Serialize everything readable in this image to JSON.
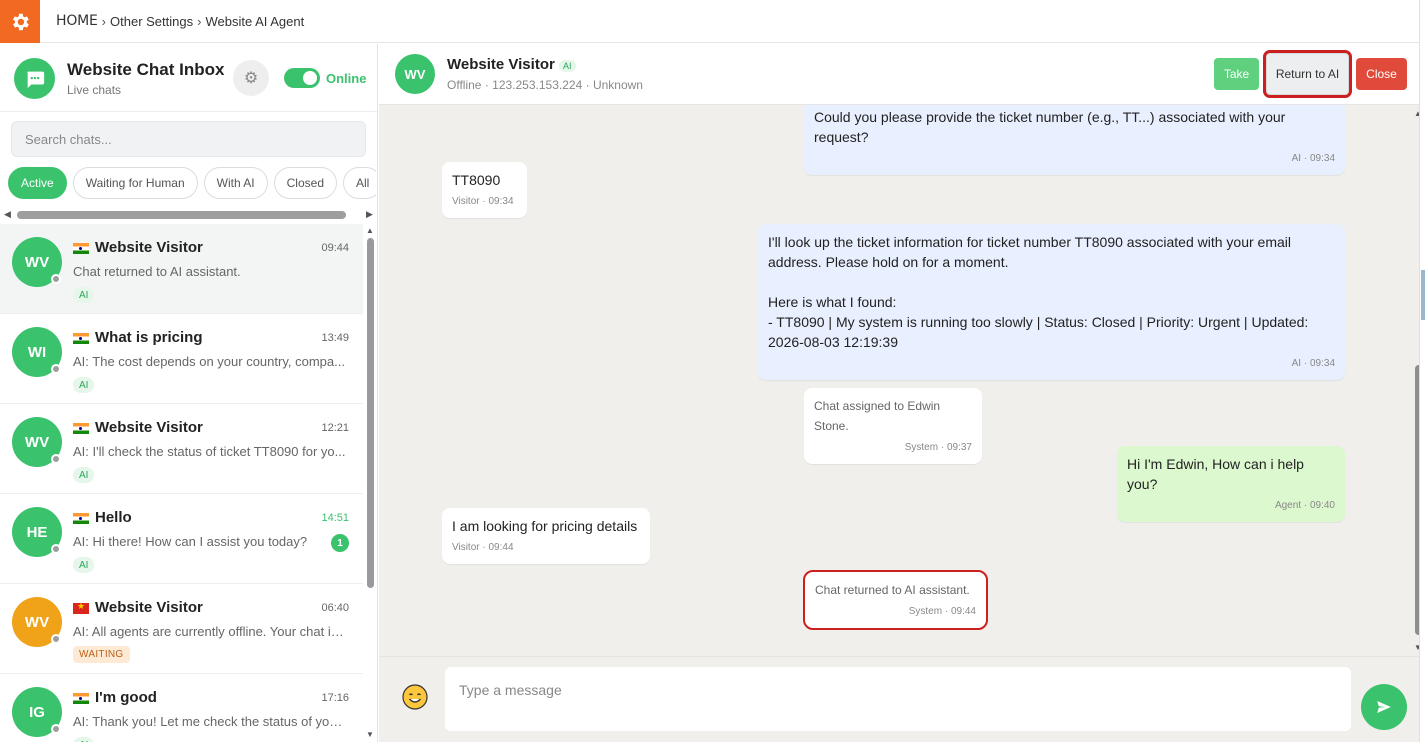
{
  "breadcrumb": {
    "home": "HOME",
    "items": [
      "Other Settings",
      "Website AI Agent"
    ]
  },
  "inbox": {
    "title": "Website Chat Inbox",
    "subtitle": "Live chats",
    "status_label": "Online",
    "search_placeholder": "Search chats...",
    "filters": [
      "Active",
      "Waiting for Human",
      "With AI",
      "Closed",
      "All"
    ],
    "active_filter": "Active",
    "chats": [
      {
        "initials": "WV",
        "flag": "in",
        "name": "Website Visitor",
        "time": "09:44",
        "preview": "Chat returned to AI assistant.",
        "badge": "AI",
        "selected": true
      },
      {
        "initials": "WI",
        "flag": "in",
        "name": "What is pricing",
        "time": "13:49",
        "preview": "AI: The cost depends on your country, compa...",
        "badge": "AI"
      },
      {
        "initials": "WV",
        "flag": "in",
        "name": "Website Visitor",
        "time": "12:21",
        "preview": "AI: I'll check the status of ticket TT8090 for yo...",
        "badge": "AI"
      },
      {
        "initials": "HE",
        "flag": "in",
        "name": "Hello",
        "time": "14:51",
        "preview": "AI: Hi there! How can I assist you today?",
        "badge": "AI",
        "unread": "1"
      },
      {
        "initials": "WV",
        "flag": "vn",
        "name": "Website Visitor",
        "time": "06:40",
        "preview": "AI: All agents are currently offline. Your chat is ...",
        "badge": "WAITING",
        "avatar_color": "orange"
      },
      {
        "initials": "IG",
        "flag": "in",
        "name": "I'm good",
        "time": "17:16",
        "preview": "AI: Thank you! Let me check the status of your...",
        "badge": "AI"
      }
    ]
  },
  "visitor": {
    "initials": "WV",
    "name": "Website Visitor",
    "tag": "AI",
    "status": "Offline",
    "ip": "123.253.153.224",
    "location": "Unknown"
  },
  "actions": {
    "take": "Take",
    "return_to_ai": "Return to AI",
    "close": "Close"
  },
  "messages": [
    {
      "sender": "ai",
      "text": "Could you please provide the ticket number (e.g., TT...) associated with your request?",
      "meta": "AI · 09:34"
    },
    {
      "sender": "visitor",
      "text": "TT8090",
      "meta": "Visitor · 09:34"
    },
    {
      "sender": "ai",
      "text": "I'll look up the ticket information for ticket number TT8090 associated with your email address. Please hold on for a moment.\n\nHere is what I found:\n- TT8090 | My system is running too slowly | Status: Closed | Priority: Urgent | Updated: 2026-08-03 12:19:39",
      "meta": "AI · 09:34"
    },
    {
      "sender": "system",
      "text": "Chat assigned to Edwin Stone.",
      "meta": "System · 09:37"
    },
    {
      "sender": "agent",
      "text": "Hi I'm Edwin, How can i help you?",
      "meta": "Agent · 09:40"
    },
    {
      "sender": "visitor",
      "text": "I am looking for pricing details",
      "meta": "Visitor · 09:44"
    },
    {
      "sender": "system",
      "text": "Chat returned to AI assistant.",
      "meta": "System · 09:44"
    }
  ],
  "composer": {
    "placeholder": "Type a message"
  },
  "colors": {
    "brand": "#f26a22",
    "accent": "#3ac26d",
    "close": "#e04a3a",
    "highlight": "#cc1f1f"
  }
}
